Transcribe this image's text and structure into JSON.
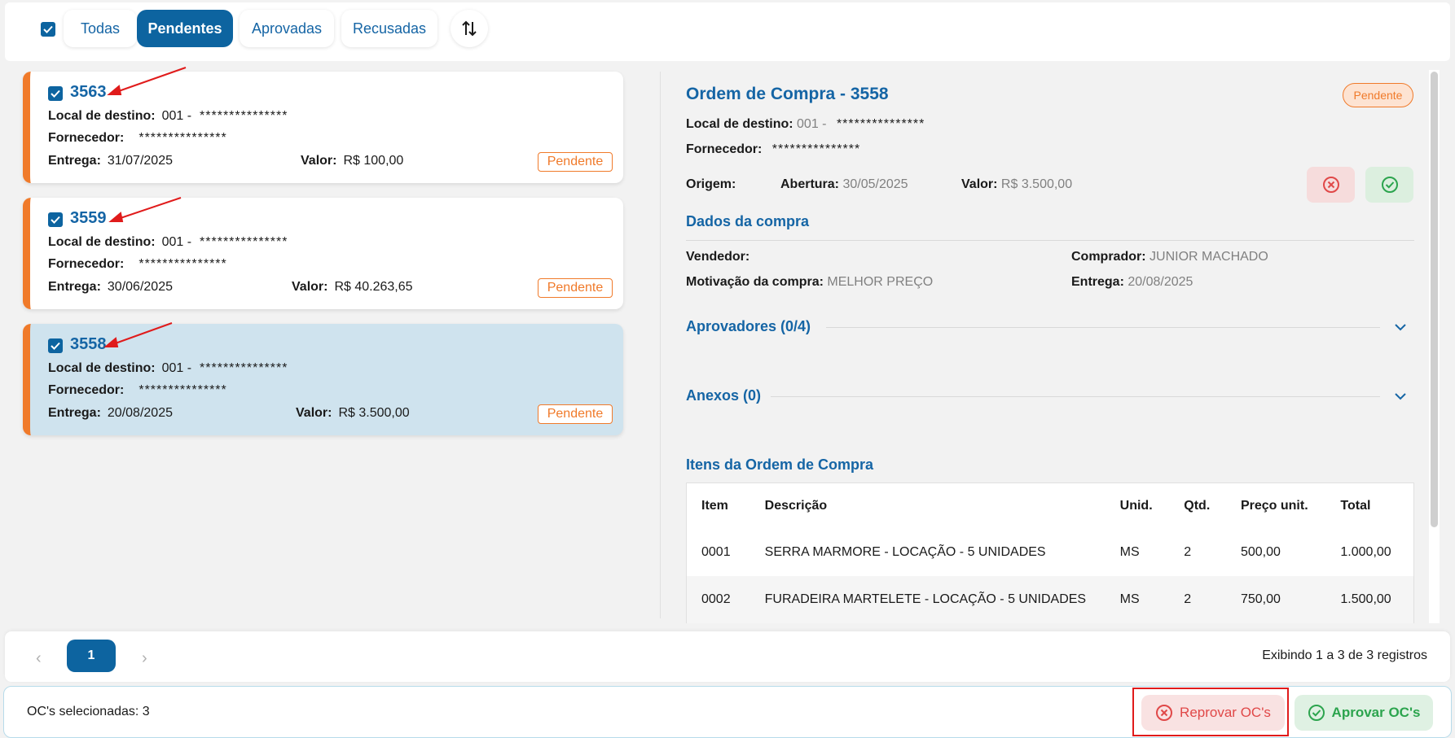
{
  "filters": {
    "tabs": [
      {
        "label": "Todas",
        "active": false
      },
      {
        "label": "Pendentes",
        "active": true
      },
      {
        "label": "Aprovadas",
        "active": false
      },
      {
        "label": "Recusadas",
        "active": false
      }
    ],
    "sort_icon": "sort-arrows-icon"
  },
  "orders": [
    {
      "number": "3563",
      "local_label": "Local de destino:",
      "local_value": "001 -",
      "local_mask": "***************",
      "fornecedor_label": "Fornecedor:",
      "fornecedor_mask": "***************",
      "entrega_label": "Entrega:",
      "entrega_value": "31/07/2025",
      "valor_label": "Valor:",
      "valor_value": "R$ 100,00",
      "status": "Pendente"
    },
    {
      "number": "3559",
      "local_label": "Local de destino:",
      "local_value": "001 -",
      "local_mask": "***************",
      "fornecedor_label": "Fornecedor:",
      "fornecedor_mask": "***************",
      "entrega_label": "Entrega:",
      "entrega_value": "30/06/2025",
      "valor_label": "Valor:",
      "valor_value": "R$ 40.263,65",
      "status": "Pendente"
    },
    {
      "number": "3558",
      "local_label": "Local de destino:",
      "local_value": "001 -",
      "local_mask": "***************",
      "fornecedor_label": "Fornecedor:",
      "fornecedor_mask": "***************",
      "entrega_label": "Entrega:",
      "entrega_value": "20/08/2025",
      "valor_label": "Valor:",
      "valor_value": "R$ 3.500,00",
      "status": "Pendente"
    }
  ],
  "detail": {
    "title": "Ordem de Compra - 3558",
    "status": "Pendente",
    "local_label": "Local de destino:",
    "local_value": "001 -",
    "local_mask": "***************",
    "fornecedor_label": "Fornecedor:",
    "fornecedor_mask": "***************",
    "origem_label": "Origem:",
    "abertura_label": "Abertura:",
    "abertura_value": "30/05/2025",
    "valor_label": "Valor:",
    "valor_value": "R$ 3.500,00",
    "dados_title": "Dados da compra",
    "vendedor_label": "Vendedor:",
    "comprador_label": "Comprador:",
    "comprador_value": "JUNIOR MACHADO",
    "motivacao_label": "Motivação da compra:",
    "motivacao_value": "MELHOR PREÇO",
    "entrega_label": "Entrega:",
    "entrega_value": "20/08/2025",
    "aprovadores_title": "Aprovadores (0/4)",
    "anexos_title": "Anexos (0)",
    "itens_title": "Itens da Ordem de Compra",
    "table": {
      "headers": [
        "Item",
        "Descrição",
        "Unid.",
        "Qtd.",
        "Preço unit.",
        "Total"
      ],
      "rows": [
        [
          "0001",
          "SERRA MARMORE - LOCAÇÃO - 5 UNIDADES",
          "MS",
          "2",
          "500,00",
          "1.000,00"
        ],
        [
          "0002",
          "FURADEIRA MARTELETE - LOCAÇÃO - 5 UNIDADES",
          "MS",
          "2",
          "750,00",
          "1.500,00"
        ]
      ]
    }
  },
  "pagination": {
    "current": "1",
    "info": "Exibindo 1 a 3 de 3 registros"
  },
  "selection": {
    "text": "OC's selecionadas: 3",
    "reject_label": "Reprovar OC's",
    "approve_label": "Aprovar OC's"
  },
  "colors": {
    "primary": "#0d64a0",
    "pending": "#f07a2a",
    "reject": "#e04848",
    "approve": "#2ca44e"
  }
}
